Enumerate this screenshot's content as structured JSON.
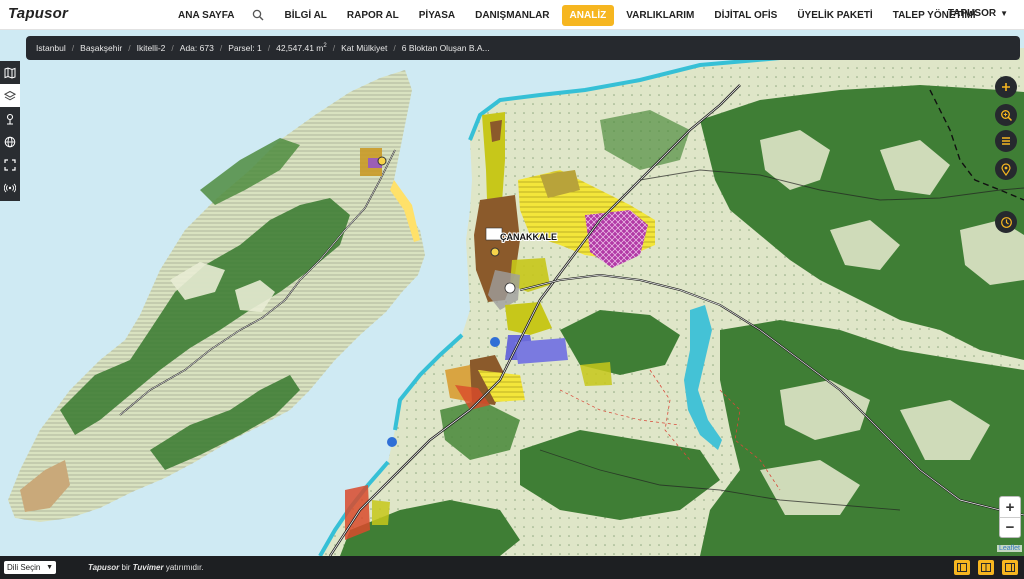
{
  "brand": "Tapusor",
  "nav": {
    "items": [
      {
        "label": "ANA SAYFA",
        "active": false
      },
      {
        "label": "BİLGİ AL",
        "active": false
      },
      {
        "label": "RAPOR AL",
        "active": false
      },
      {
        "label": "PİYASA",
        "active": false
      },
      {
        "label": "DANIŞMANLAR",
        "active": false
      },
      {
        "label": "ANALİZ",
        "active": true
      },
      {
        "label": "VARLIKLARIM",
        "active": false
      },
      {
        "label": "DİJİTAL OFİS",
        "active": false
      },
      {
        "label": "ÜYELİK PAKETİ",
        "active": false
      },
      {
        "label": "TALEP YÖNETİMİ",
        "active": false
      }
    ],
    "search_icon": "search-icon",
    "user": "TAPUSOR"
  },
  "breadcrumb": {
    "city": "Istanbul",
    "district": "Başakşehir",
    "neighborhood": "Ikitelli-2",
    "ada": "Ada: 673",
    "parsel": "Parsel: 1",
    "area_value": "42,547.41 m",
    "area_unit_sup": "2",
    "type": "Kat Mülkiyet",
    "description": "6 Bloktan Oluşan B.A..."
  },
  "left_tools": [
    {
      "icon": "map-icon",
      "selected": false
    },
    {
      "icon": "layers-icon",
      "selected": true
    },
    {
      "icon": "location-pin-icon",
      "selected": false
    },
    {
      "icon": "globe-icon",
      "selected": false
    },
    {
      "icon": "fullscreen-icon",
      "selected": false
    },
    {
      "icon": "broadcast-icon",
      "selected": false
    }
  ],
  "right_tools": [
    "plus-icon",
    "zoom-search-icon",
    "menu-icon",
    "map-marker-icon",
    "clock-icon"
  ],
  "map": {
    "place_label": "ÇANAKKALE",
    "attribution": "Leaflet",
    "zoom_in": "+",
    "zoom_out": "−"
  },
  "footer": {
    "language": "Dili Seçin",
    "brand": "Tapusor",
    "text_mid": " bir ",
    "partner": "Tuvimer",
    "text_end": " yatırımıdır."
  },
  "colors": {
    "accent": "#f6b620",
    "dark_panel": "#26292e",
    "sea": "#cfeaf3",
    "forest": "#3f7e35",
    "land_light": "#dfe6c8"
  }
}
